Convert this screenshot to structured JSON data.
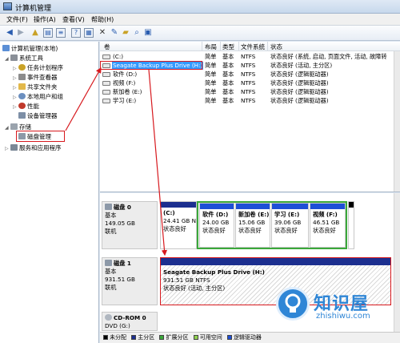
{
  "window": {
    "title": "计算机管理"
  },
  "menu": [
    "文件(F)",
    "操作(A)",
    "查看(V)",
    "帮助(H)"
  ],
  "tree": {
    "root": "计算机管理(本地)",
    "system_tools": "系统工具",
    "task_scheduler": "任务计划程序",
    "event_viewer": "事件查看器",
    "shared_folders": "共享文件夹",
    "local_users": "本地用户和组",
    "performance": "性能",
    "device_manager": "设备管理器",
    "storage": "存储",
    "disk_management": "磁盘管理",
    "services_apps": "服务和应用程序"
  },
  "volume_table": {
    "headers": [
      "卷",
      "布局",
      "类型",
      "文件系统",
      "状态"
    ],
    "rows": [
      {
        "name": "(C:)",
        "layout": "简单",
        "type": "基本",
        "fs": "NTFS",
        "status": "状态良好 (系统, 启动, 页面文件, 活动, 故障转"
      },
      {
        "name": "Seagate Backup Plus Drive (H:)",
        "layout": "简单",
        "type": "基本",
        "fs": "NTFS",
        "status": "状态良好 (活动, 主分区)"
      },
      {
        "name": "软件 (D:)",
        "layout": "简单",
        "type": "基本",
        "fs": "NTFS",
        "status": "状态良好 (逻辑驱动器)"
      },
      {
        "name": "视频 (F:)",
        "layout": "简单",
        "type": "基本",
        "fs": "NTFS",
        "status": "状态良好 (逻辑驱动器)"
      },
      {
        "name": "新加卷 (E:)",
        "layout": "简单",
        "type": "基本",
        "fs": "NTFS",
        "status": "状态良好 (逻辑驱动器)"
      },
      {
        "name": "学习 (E:)",
        "layout": "简单",
        "type": "基本",
        "fs": "NTFS",
        "status": "状态良好 (逻辑驱动器)"
      }
    ]
  },
  "disk0": {
    "name": "磁盘 0",
    "type": "基本",
    "size": "149.05 GB",
    "state": "联机",
    "partitions": [
      {
        "name": "(C:)",
        "size": "24.41 GB N",
        "status": "状态良好"
      },
      {
        "name": "软件 (D:)",
        "size": "24.00 GB",
        "status": "状态良好"
      },
      {
        "name": "新加卷 (E:)",
        "size": "15.06 GB",
        "status": "状态良好"
      },
      {
        "name": "学习 (E:)",
        "size": "39.06 GB",
        "status": "状态良好"
      },
      {
        "name": "视频 (F:)",
        "size": "46.51 GB",
        "status": "状态良好"
      }
    ]
  },
  "disk1": {
    "name": "磁盘 1",
    "type": "基本",
    "size": "931.51 GB",
    "state": "联机",
    "partition": {
      "name": "Seagate Backup Plus Drive (H:)",
      "size": "931.51 GB NTFS",
      "status": "状态良好 (活动, 主分区)"
    }
  },
  "cdrom": {
    "name": "CD-ROM 0",
    "drive": "DVD (G:)"
  },
  "legend": [
    {
      "label": "未分配",
      "color": "#000000"
    },
    {
      "label": "主分区",
      "color": "#1c2f8f"
    },
    {
      "label": "扩展分区",
      "color": "#3aa83a"
    },
    {
      "label": "可用空间",
      "color": "#8fd14f"
    },
    {
      "label": "逻辑驱动器",
      "color": "#1e4fd6"
    }
  ],
  "watermark": {
    "title": "知识屋",
    "url": "zhishiwu.com"
  },
  "colors": {
    "selection": "#3399ff",
    "highlight_red": "#d7191e",
    "primary": "#1c2f8f",
    "logical": "#1e4fd6",
    "extended": "#3aa83a"
  }
}
